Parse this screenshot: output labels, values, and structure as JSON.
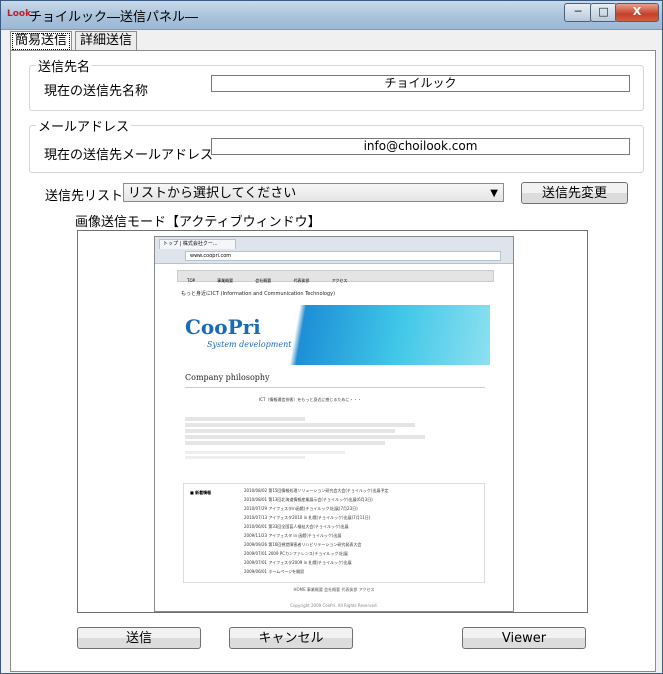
{
  "window": {
    "title": "チョイルック―送信パネル―",
    "app_icon": "choilook-logo-icon",
    "min_label": "─",
    "max_label": "□",
    "close_label": "X"
  },
  "tabs": [
    "簡易送信",
    "詳細送信"
  ],
  "recipient_name": {
    "group_label": "送信先名",
    "field_label": "現在の送信先名称",
    "value": "チョイルック"
  },
  "email": {
    "group_label": "メールアドレス",
    "field_label": "現在の送信先メールアドレス",
    "value": "info@choilook.com"
  },
  "list": {
    "label": "送信先リスト",
    "selected": "リストから選択してください",
    "change_button": "送信先変更"
  },
  "preview": {
    "mode_label": "画像送信モード【アクティブウィンドウ】",
    "browser": {
      "tab": "トップ | 株式会社クー...",
      "url": "www.coopri.com",
      "nav": [
        "TOP",
        "事業概要",
        "会社概要",
        "代表挨拶",
        "アクセス"
      ],
      "tagline": "もっと身近にICT (Information and Communication Technology)",
      "logo": "CooPri",
      "logo_sub": "System development",
      "philosophy": "Company philosophy",
      "message": "ICT（情報通信技術）をもっと身近に感じるために・・・",
      "news_heading": "■ 新着情報",
      "news": [
        "2010/08/02  第15回情報処理ソリューション研究会大会(チョイルック)出展予定",
        "2010/08/01  第13回北海道情報産業展示会(チョイルック)出展(6月3日)",
        "2010/07/29  アイフェスタin函館(チョイルック)出展(7月23日)",
        "2010/07/13  アイフェスタ2010 in 札幌(チョイルック)出展(7月11日)",
        "2010/06/01  第33回全国盲人福祉大会(チョイルック)出展",
        "2009/11/23  アイフェスタ in 函館(チョイルック)出展",
        "2009/09/26  第16回視覚障害者リハビリテーション研究発表大会",
        "2009/07/01  2009 PCカンファレンス(チョイルック)出展",
        "2009/07/01  アイフェスタ2009 in 札幌(チョイルック)出展",
        "2009/06/01  ホームページを開設"
      ],
      "footer": "HOME   事業概要   会社概要   代表挨拶   アクセス",
      "copyright": "Copyright 2009 CooPri. All Rights Reserved."
    }
  },
  "buttons": {
    "send": "送信",
    "cancel": "キャンセル",
    "viewer": "Viewer"
  }
}
